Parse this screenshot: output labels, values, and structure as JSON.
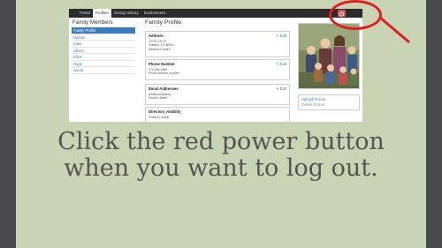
{
  "nav": {
    "items": [
      "Portal",
      "Profiles",
      "Giving History",
      "Involvement"
    ],
    "active_index": 1
  },
  "power_button": {
    "icon": "power-icon",
    "color": "#d94b4b"
  },
  "sidebar": {
    "title": "Family Members",
    "items": [
      "Family Profile",
      "Nathan",
      "Katie",
      "Jabed",
      "Eliza",
      "Hope",
      "Jacob"
    ]
  },
  "main": {
    "title": "Family Profile",
    "edit_label": "Edit",
    "cards": {
      "address": {
        "head": "Address",
        "lines": [
          "12703 CR 37",
          "Greeley, CO 80631",
          "Address is listed"
        ]
      },
      "phone": {
        "head": "Phone Number",
        "lines": [
          "970-284-4896",
          "Phone number is listed"
        ]
      },
      "email": {
        "head": "Email Addresses",
        "lines": [
          "[email protected]",
          "Email is listed"
        ]
      },
      "visibility": {
        "head": "Directory visibility",
        "lines": [
          "Profile is visible"
        ]
      }
    }
  },
  "photo": {
    "upload_label": "Upload Picture",
    "delete_label": "Delete Picture"
  },
  "annotation": {
    "color": "#e02020"
  },
  "caption": {
    "line1": "Click the red power button",
    "line2": "when you want to log out."
  }
}
